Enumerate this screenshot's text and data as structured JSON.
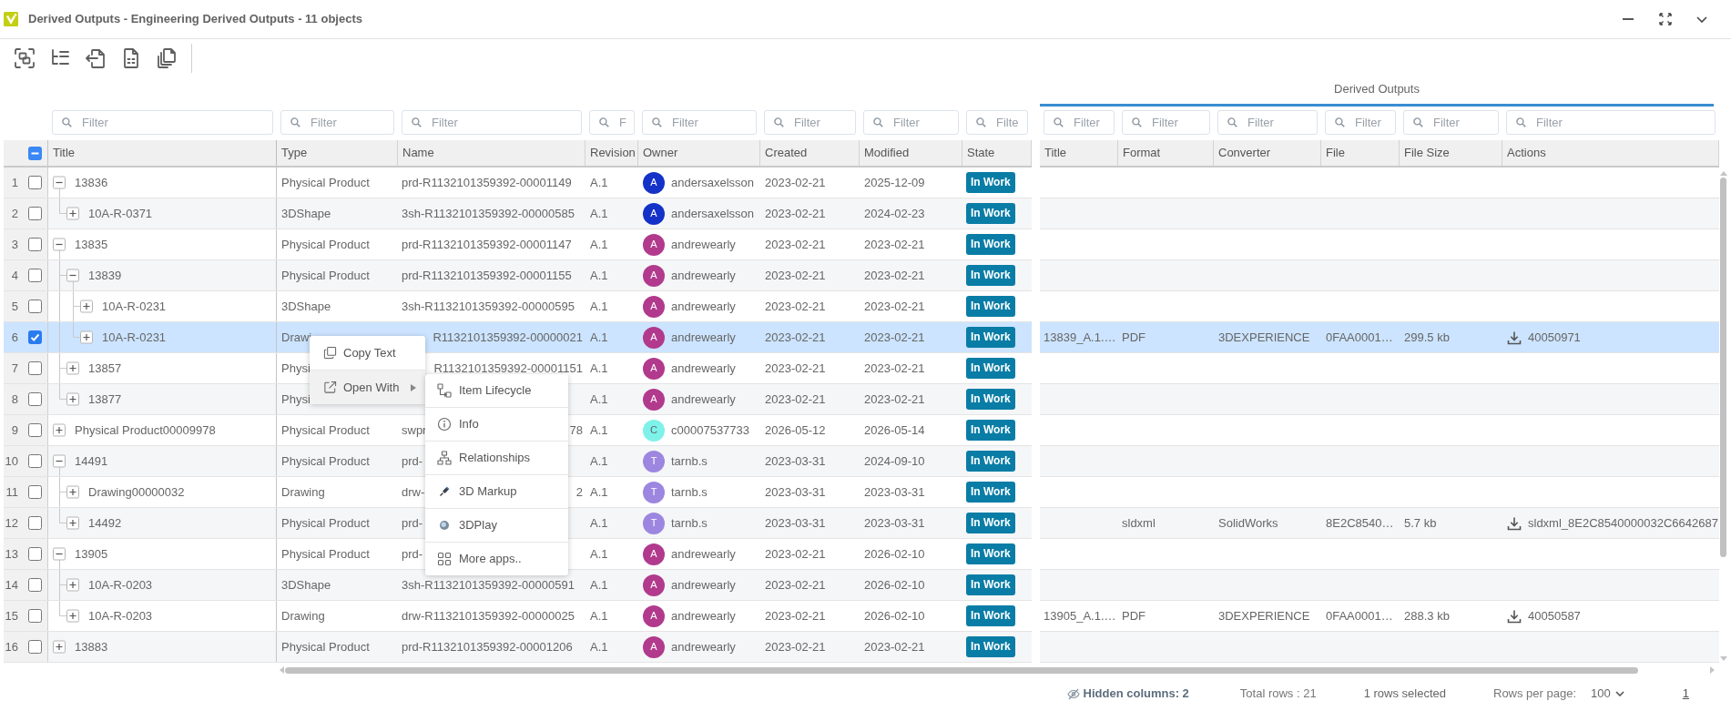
{
  "window": {
    "title": "Derived Outputs - Engineering Derived Outputs - 11 objects"
  },
  "table": {
    "select_all": {
      "indeterminate": true
    },
    "columns": [
      {
        "label": "Title",
        "placeholder": "Filter"
      },
      {
        "label": "Type",
        "placeholder": "Filter"
      },
      {
        "label": "Name",
        "placeholder": "Filter"
      },
      {
        "label": "Revision",
        "placeholder": "F"
      },
      {
        "label": "Owner",
        "placeholder": "Filter"
      },
      {
        "label": "Created",
        "placeholder": "Filter"
      },
      {
        "label": "Modified",
        "placeholder": "Filter"
      },
      {
        "label": "State",
        "placeholder": "Filte"
      }
    ],
    "derived_outputs": {
      "title": "Derived Outputs",
      "columns": [
        {
          "label": "Title",
          "placeholder": "Filter"
        },
        {
          "label": "Format",
          "placeholder": "Filter"
        },
        {
          "label": "Converter",
          "placeholder": "Filter"
        },
        {
          "label": "File",
          "placeholder": "Filter"
        },
        {
          "label": "File Size",
          "placeholder": "Filter"
        },
        {
          "label": "Actions",
          "placeholder": "Filter"
        }
      ]
    },
    "rows": [
      {
        "number": "1",
        "checked": false,
        "selected": false,
        "expanded": true,
        "title": "13836",
        "type": "Physical Product",
        "name": "prd-R1132101359392-00001149",
        "revision": "A.1",
        "owner": {
          "initial": "A",
          "name": "andersaxelsson",
          "color": "#1431c8"
        },
        "created": "2023-02-21",
        "modified": "2025-12-09",
        "state": "In Work",
        "children": [
          {
            "number": "2",
            "checked": false,
            "selected": false,
            "expanded": false,
            "title": "10A-R-0371",
            "type": "3DShape",
            "name": "3sh-R1132101359392-00000585",
            "revision": "A.1",
            "owner": {
              "initial": "A",
              "name": "andersaxelsson",
              "color": "#1431c8"
            },
            "created": "2023-02-21",
            "modified": "2024-02-23",
            "state": "In Work"
          }
        ]
      },
      {
        "number": "3",
        "checked": false,
        "selected": false,
        "expanded": true,
        "title": "13835",
        "type": "Physical Product",
        "name": "prd-R1132101359392-00001147",
        "revision": "A.1",
        "owner": {
          "initial": "A",
          "name": "andrewearly",
          "color": "#b13a8d"
        },
        "created": "2023-02-21",
        "modified": "2023-02-21",
        "state": "In Work",
        "children": [
          {
            "number": "4",
            "checked": false,
            "selected": false,
            "expanded": true,
            "title": "13839",
            "type": "Physical Product",
            "name": "prd-R1132101359392-00001155",
            "revision": "A.1",
            "owner": {
              "initial": "A",
              "name": "andrewearly",
              "color": "#b13a8d"
            },
            "created": "2023-02-21",
            "modified": "2023-02-21",
            "state": "In Work",
            "children": [
              {
                "number": "5",
                "checked": false,
                "selected": false,
                "expanded": false,
                "title": "10A-R-0231",
                "type": "3DShape",
                "name": "3sh-R1132101359392-00000595",
                "revision": "A.1",
                "owner": {
                  "initial": "A",
                  "name": "andrewearly",
                  "color": "#b13a8d"
                },
                "created": "2023-02-21",
                "modified": "2023-02-21",
                "state": "In Work"
              },
              {
                "number": "6",
                "checked": true,
                "selected": true,
                "expanded": false,
                "title": "10A-R-0231",
                "type": "Drawi",
                "name_end": "R1132101359392-00000021",
                "revision": "A.1",
                "owner": {
                  "initial": "A",
                  "name": "andrewearly",
                  "color": "#b13a8d"
                },
                "created": "2023-02-21",
                "modified": "2023-02-21",
                "state": "In Work",
                "output": {
                  "title": "13839_A.1.…",
                  "format": "PDF",
                  "converter": "3DEXPERIENCE",
                  "file": "0FAA0001…",
                  "file_size": "299.5 kb",
                  "action": "40050971"
                }
              }
            ]
          },
          {
            "number": "7",
            "checked": false,
            "selected": false,
            "expanded": false,
            "title": "13857",
            "type": "Physi",
            "name_end": "R1132101359392-00001151",
            "revision": "A.1",
            "owner": {
              "initial": "A",
              "name": "andrewearly",
              "color": "#b13a8d"
            },
            "created": "2023-02-21",
            "modified": "2023-02-21",
            "state": "In Work"
          },
          {
            "number": "8",
            "checked": false,
            "selected": false,
            "expanded": false,
            "title": "13877",
            "type": "Physi",
            "revision": "A.1",
            "owner": {
              "initial": "A",
              "name": "andrewearly",
              "color": "#b13a8d"
            },
            "created": "2023-02-21",
            "modified": "2023-02-21",
            "state": "In Work"
          }
        ]
      },
      {
        "number": "9",
        "checked": false,
        "selected": false,
        "expanded": false,
        "title": "Physical Product00009978",
        "type": "Physical Product",
        "name": "swpr",
        "name_end": "78",
        "revision": "A.1",
        "owner": {
          "initial": "C",
          "name": "c00007537733",
          "color": "#7ef2e9"
        },
        "created": "2026-05-12",
        "modified": "2026-05-14",
        "state": "In Work"
      },
      {
        "number": "10",
        "checked": false,
        "selected": false,
        "expanded": true,
        "title": "14491",
        "type": "Physical Product",
        "name": "prd-",
        "revision": "A.1",
        "owner": {
          "initial": "T",
          "name": "tarnb.s",
          "color": "#9c86e0"
        },
        "created": "2023-03-31",
        "modified": "2024-09-10",
        "state": "In Work",
        "children": [
          {
            "number": "11",
            "checked": false,
            "selected": false,
            "expanded": false,
            "title": "Drawing00000032",
            "type": "Drawing",
            "name": "drw-",
            "name_end": "2",
            "revision": "A.1",
            "owner": {
              "initial": "T",
              "name": "tarnb.s",
              "color": "#9c86e0"
            },
            "created": "2023-03-31",
            "modified": "2023-03-31",
            "state": "In Work"
          },
          {
            "number": "12",
            "checked": false,
            "selected": false,
            "expanded": false,
            "title": "14492",
            "type": "Physical Product",
            "name": "prd-",
            "revision": "A.1",
            "owner": {
              "initial": "T",
              "name": "tarnb.s",
              "color": "#9c86e0"
            },
            "created": "2023-03-31",
            "modified": "2023-03-31",
            "state": "In Work",
            "output": {
              "format": "sldxml",
              "converter": "SolidWorks",
              "file": "8E2C8540…",
              "file_size": "5.7 kb",
              "action": "sldxml_8E2C8540000032C6642687"
            }
          }
        ]
      },
      {
        "number": "13",
        "checked": false,
        "selected": false,
        "expanded": true,
        "title": "13905",
        "type": "Physical Product",
        "name": "prd-",
        "revision": "A.1",
        "owner": {
          "initial": "A",
          "name": "andrewearly",
          "color": "#b13a8d"
        },
        "created": "2023-02-21",
        "modified": "2026-02-10",
        "state": "In Work",
        "children": [
          {
            "number": "14",
            "checked": false,
            "selected": false,
            "expanded": false,
            "title": "10A-R-0203",
            "type": "3DShape",
            "name": "3sh-R1132101359392-00000591",
            "revision": "A.1",
            "owner": {
              "initial": "A",
              "name": "andrewearly",
              "color": "#b13a8d"
            },
            "created": "2023-02-21",
            "modified": "2026-02-10",
            "state": "In Work"
          },
          {
            "number": "15",
            "checked": false,
            "selected": false,
            "expanded": false,
            "title": "10A-R-0203",
            "type": "Drawing",
            "name": "drw-R1132101359392-00000025",
            "revision": "A.1",
            "owner": {
              "initial": "A",
              "name": "andrewearly",
              "color": "#b13a8d"
            },
            "created": "2023-02-21",
            "modified": "2026-02-10",
            "state": "In Work",
            "output": {
              "title": "13905_A.1.…",
              "format": "PDF",
              "converter": "3DEXPERIENCE",
              "file": "0FAA0001…",
              "file_size": "288.3 kb",
              "action": "40050587"
            }
          }
        ]
      },
      {
        "number": "16",
        "checked": false,
        "selected": false,
        "expanded": false,
        "title": "13883",
        "type": "Physical Product",
        "name": "prd-R1132101359392-00001206",
        "revision": "A.1",
        "owner": {
          "initial": "A",
          "name": "andrewearly",
          "color": "#b13a8d"
        },
        "created": "2023-02-21",
        "modified": "2023-02-21",
        "state": "In Work"
      }
    ]
  },
  "context_menu": {
    "items": [
      {
        "kind": "copy",
        "label": "Copy Text",
        "selected": false
      },
      {
        "kind": "open",
        "label": "Open With",
        "selected": true,
        "submenu": [
          {
            "kind": "lifecycle",
            "label": "Item Lifecycle",
            "selected": false
          },
          {
            "kind": "info",
            "label": "Info",
            "selected": false
          },
          {
            "kind": "relationships",
            "label": "Relationships",
            "selected": false
          },
          {
            "kind": "markup",
            "label": "3D Markup",
            "selected": false
          },
          {
            "kind": "play",
            "label": "3DPlay",
            "selected": false
          },
          {
            "kind": "apps",
            "label": "More apps..",
            "selected": false
          }
        ]
      }
    ]
  },
  "footer": {
    "hidden_columns": "Hidden columns: 2",
    "total_rows": "Total rows : 21",
    "selected_rows": "1 rows selected",
    "rows_per_page_label": "Rows per page:",
    "rows_per_page": "100",
    "page": "1"
  }
}
